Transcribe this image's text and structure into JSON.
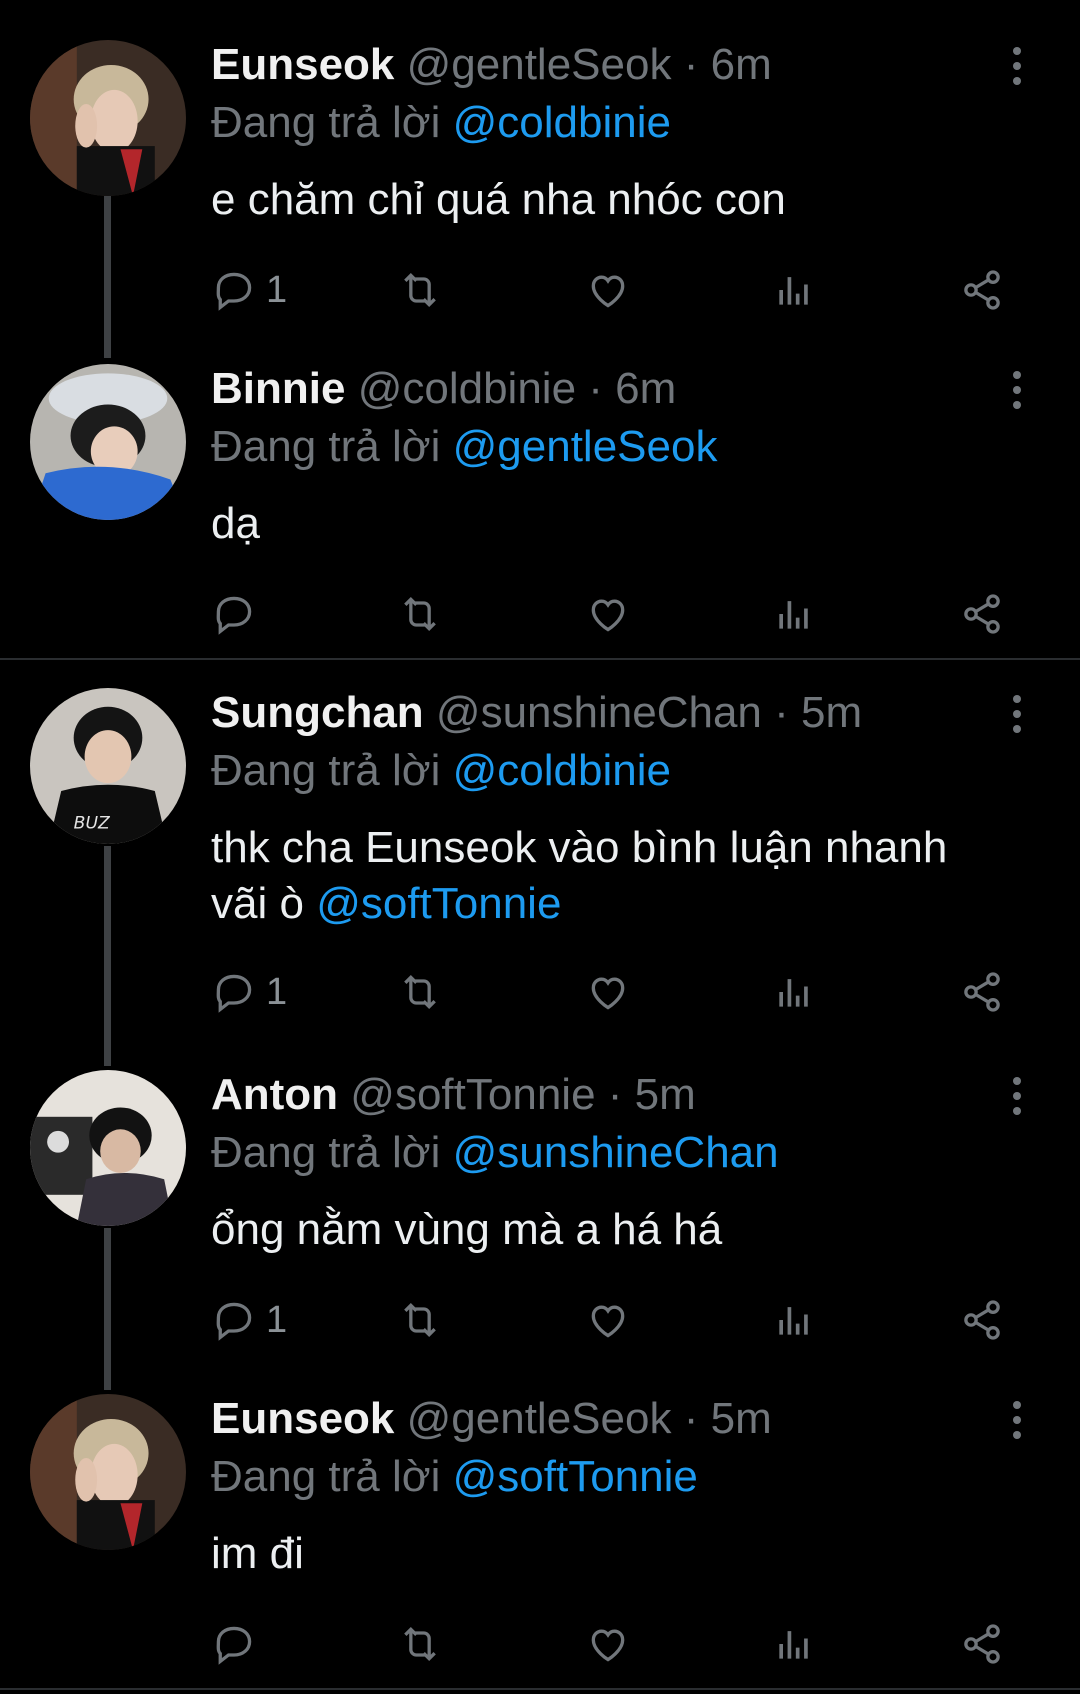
{
  "tweets": [
    {
      "name": "Eunseok",
      "handle": "@gentleSeok",
      "time": "6m",
      "reply_label": "Đang trả lời",
      "reply_to": "@coldbinie",
      "text": "e chăm chỉ quá nha nhóc con",
      "reply_count": "1",
      "avatar": "avatar-eunseok"
    },
    {
      "name": "Binnie",
      "handle": "@coldbinie",
      "time": "6m",
      "reply_label": "Đang trả lời",
      "reply_to": "@gentleSeok",
      "text": "dạ",
      "reply_count": "",
      "avatar": "avatar-binnie"
    },
    {
      "name": "Sungchan",
      "handle": "@sunshineChan",
      "time": "5m",
      "reply_label": "Đang trả lời",
      "reply_to": "@coldbinie",
      "text_line1": "thk cha Eunseok vào bình luận nhanh",
      "text_line2_prefix": "vãi ò",
      "text_mention": "@softTonnie",
      "reply_count": "1",
      "avatar": "avatar-sungchan"
    },
    {
      "name": "Anton",
      "handle": "@softTonnie",
      "time": "5m",
      "reply_label": "Đang trả lời",
      "reply_to": "@sunshineChan",
      "text": "ổng nằm vùng mà a há há",
      "reply_count": "1",
      "avatar": "avatar-anton"
    },
    {
      "name": "Eunseok",
      "handle": "@gentleSeok",
      "time": "5m",
      "reply_label": "Đang trả lời",
      "reply_to": "@softTonnie",
      "text": "im đi",
      "reply_count": "",
      "avatar": "avatar-eunseok"
    }
  ],
  "separator": "·",
  "icons": [
    "reply-icon",
    "retweet-icon",
    "like-icon",
    "views-icon",
    "share-icon",
    "more-icon"
  ],
  "colors": {
    "background": "#000000",
    "mention": "#1d9bf0",
    "muted": "#71767b",
    "thread_line": "#3e4144"
  }
}
